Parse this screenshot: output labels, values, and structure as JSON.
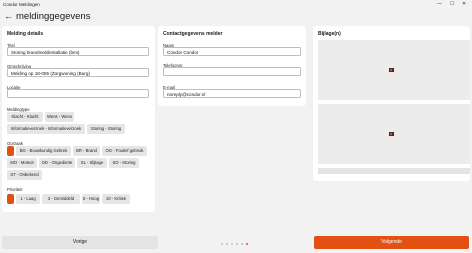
{
  "window": {
    "app_title": "Condor Meldingen",
    "minimize": "—",
    "maximize": "☐",
    "close": "✕"
  },
  "header": {
    "back_glyph": "←",
    "title": "meldinggegevens"
  },
  "melding": {
    "section_title": "Melding details",
    "title_label": "Titel",
    "title_value": "Storing brandmeldinstallatie (bmi)",
    "description_label": "Omschrijving",
    "description_value": "Melding op 18-055 (Zorgwoning (Burg)",
    "location_label": "Locatie",
    "location_value": "",
    "type_label": "Meldingtype",
    "types": [
      "Klacht - Klacht",
      "Wens - Wens",
      "Informatieverzoek - Informatieverzoek",
      "Storing - Storing"
    ],
    "cause_label": "Oorzaak",
    "causes": [
      "BG - Bouwkundig Gebrek",
      "BR - Brand",
      "OG - Foutief gebruik",
      "MO - Moteot",
      "OD - Ongedierte",
      "SL - Slijtage",
      "SO - Storing",
      "ST - Onbekend"
    ],
    "priority_label": "Prioriteit",
    "priorities": [
      "1 - Laag",
      "3 - Gemiddeld",
      "5 - Hoog",
      "10 - Kritiek"
    ]
  },
  "contact": {
    "section_title": "Contactgegevens melder",
    "name_label": "Naam",
    "name_value": "Condor Condor",
    "phone_label": "Telefoonnr.",
    "phone_value": "",
    "email_label": "E-mail",
    "email_value": "noreply@condor.nl"
  },
  "attachments": {
    "section_title": "Bijlage(n)"
  },
  "footer": {
    "prev_label": "Vorige",
    "next_label": "Volgende",
    "pages": 6,
    "active_page": 6
  },
  "colors": {
    "accent": "#e25112",
    "chip": "#e6e6e6",
    "background": "#f2f2f2"
  },
  "icons": [
    "back-arrow-icon",
    "image-placeholder-icon",
    "minimize-icon",
    "maximize-icon",
    "close-icon"
  ]
}
